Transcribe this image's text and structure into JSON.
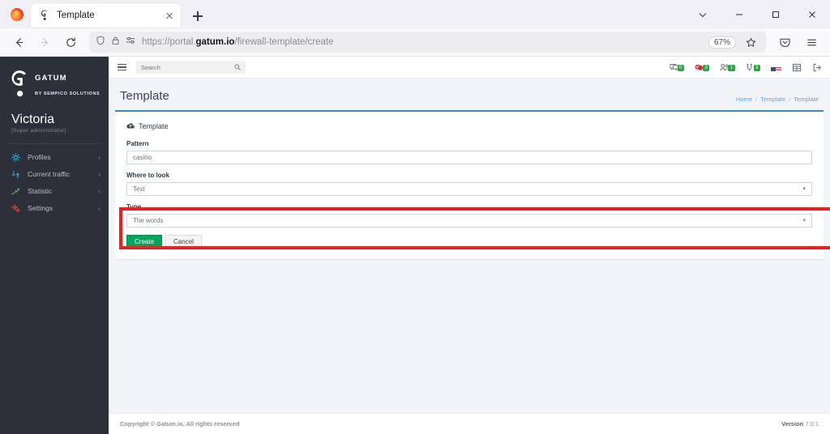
{
  "browser": {
    "tab": {
      "title": "Template",
      "favicon": "gatum-logo-icon",
      "close_icon": "close-icon"
    },
    "new_tab_icon": "plus-icon",
    "window_controls": {
      "list_tabs": "chevron-down-icon",
      "minimize": "minimize-icon",
      "maximize": "maximize-icon",
      "close": "close-icon"
    },
    "nav": {
      "back_icon": "back-arrow-icon",
      "forward_icon": "forward-arrow-icon",
      "reload_icon": "reload-icon",
      "shield_icon": "shield-icon",
      "lock_icon": "lock-icon",
      "permissions_icon": "permissions-icon",
      "url_scheme": "https://",
      "url_subdomain": "portal.",
      "url_domain": "gatum.io",
      "url_path": "/firewall-template/create",
      "zoom_level": "67%",
      "bookmark_icon": "star-icon",
      "pocket_icon": "pocket-icon",
      "menu_icon": "hamburger-menu-icon"
    }
  },
  "sidebar": {
    "brand": {
      "name": "GATUM",
      "subtitle": "BY SEMPICO SOLUTIONS",
      "logo_icon": "gatum-logo-icon"
    },
    "user": {
      "name": "Victoria",
      "role": "[Super administrator]"
    },
    "items": [
      {
        "label": "Profiles",
        "icon": "profiles-gear-icon",
        "chevron": "‹",
        "color": "#2196f3"
      },
      {
        "label": "Current traffic",
        "icon": "traffic-arrows-icon",
        "chevron": "‹",
        "color": "#2196f3"
      },
      {
        "label": "Statistic",
        "icon": "statistic-chart-icon",
        "chevron": "‹",
        "color": "#4caf50"
      },
      {
        "label": "Settings",
        "icon": "settings-gears-icon",
        "chevron": "‹",
        "color": "#e53935"
      }
    ]
  },
  "topnav": {
    "menu_toggle_icon": "hamburger-menu-icon",
    "search": {
      "placeholder": "Search",
      "value": "",
      "icon": "search-icon"
    },
    "icons": [
      {
        "name": "messages-icon",
        "badge": "0"
      },
      {
        "name": "notifications-icon",
        "badge": "3"
      },
      {
        "name": "users-icon",
        "badge": "1"
      },
      {
        "name": "tasks-icon",
        "badge": "3"
      },
      {
        "name": "language-flag-icon",
        "badge": ""
      },
      {
        "name": "grid-apps-icon",
        "badge": ""
      },
      {
        "name": "logout-icon",
        "badge": ""
      }
    ]
  },
  "page": {
    "title": "Template",
    "breadcrumb": [
      {
        "label": "Home",
        "link": true
      },
      {
        "label": "Template",
        "link": true
      },
      {
        "label": "Template",
        "link": false
      }
    ],
    "breadcrumb_separator": "/"
  },
  "card": {
    "header_icon": "cloud-upload-icon",
    "header_title": "Template",
    "accent_color": "#3c8dbc",
    "fields": [
      {
        "label": "Pattern",
        "value": "casino",
        "type": "text"
      },
      {
        "label": "Where to look",
        "value": "Text",
        "type": "select"
      },
      {
        "label": "Type",
        "value": "The words",
        "type": "select"
      }
    ],
    "buttons": {
      "create": "Create",
      "cancel": "Cancel",
      "create_color": "#00a65a"
    },
    "highlight_color": "#f01d1d"
  },
  "footer": {
    "copyright": "Copyright © Gatum.io. All rights reserved",
    "version_label": "Version",
    "version_number": "7.0.1"
  }
}
